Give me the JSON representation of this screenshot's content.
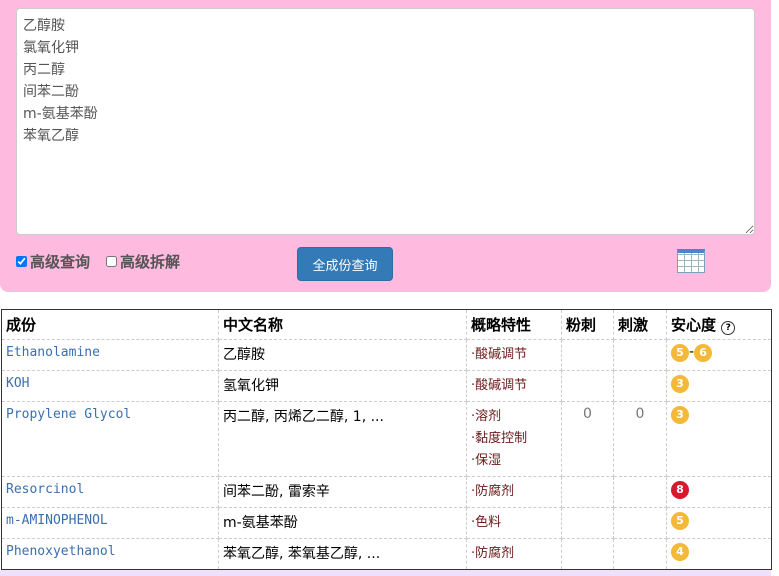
{
  "input": {
    "text": "乙醇胺\n氯氧化钾\n丙二醇\n间苯二酚\nm-氨基苯酚\n苯氧乙醇"
  },
  "options": {
    "advanced_query": "高级查询",
    "advanced_split": "高级拆解"
  },
  "query_button": "全成份查询",
  "table": {
    "headers": [
      "成份",
      "中文名称",
      "概略特性",
      "粉刺",
      "刺激",
      "安心度"
    ],
    "rows": [
      {
        "en": "Ethanolamine",
        "cn": "乙醇胺",
        "props": [
          "·酸碱调节"
        ],
        "acne": "",
        "irritant": "",
        "safety": [
          "5",
          "6"
        ],
        "sep": "-"
      },
      {
        "en": "KOH",
        "cn": "氢氧化钾",
        "props": [
          "·酸碱调节"
        ],
        "acne": "",
        "irritant": "",
        "safety": [
          "3"
        ]
      },
      {
        "en": "Propylene Glycol",
        "cn": "丙二醇, 丙烯乙二醇, 1, ...",
        "props": [
          "·溶剂",
          "·黏度控制",
          "·保湿"
        ],
        "acne": "0",
        "irritant": "0",
        "safety": [
          "3"
        ]
      },
      {
        "en": "Resorcinol",
        "cn": "间苯二酚, 雷索辛",
        "props": [
          "·防腐剂"
        ],
        "acne": "",
        "irritant": "",
        "safety": [
          "8"
        ]
      },
      {
        "en": "m-AMINOPHENOL",
        "cn": "m-氨基苯酚",
        "props": [
          "·色料"
        ],
        "acne": "",
        "irritant": "",
        "safety": [
          "5"
        ]
      },
      {
        "en": "Phenoxyethanol",
        "cn": "苯氧乙醇, 苯氧基乙醇, ...",
        "props": [
          "·防腐剂"
        ],
        "acne": "",
        "irritant": "",
        "safety": [
          "4"
        ]
      }
    ]
  },
  "colors": {
    "moderate": "#f5b93a",
    "high": "#d9182d",
    "panel": "#ffbadf"
  }
}
